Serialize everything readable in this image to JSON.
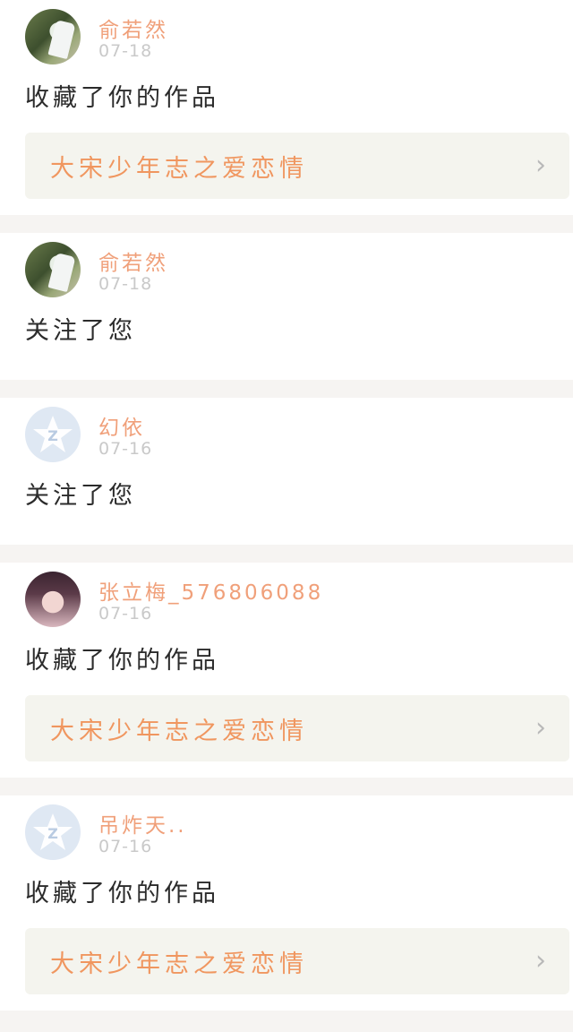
{
  "feed": {
    "items": [
      {
        "user": "俞若然",
        "time": "07-18",
        "action": "收藏了你的作品",
        "work_title": "大宋少年志之爱恋情",
        "avatar": "photo-outdoor"
      },
      {
        "user": "俞若然",
        "time": "07-18",
        "action": "关注了您",
        "avatar": "photo-outdoor"
      },
      {
        "user": "幻依",
        "time": "07-16",
        "action": "关注了您",
        "avatar": "default-qq-icon"
      },
      {
        "user": "张立梅_576806088",
        "time": "07-16",
        "action": "收藏了你的作品",
        "work_title": "大宋少年志之爱恋情",
        "avatar": "photo-girl"
      },
      {
        "user": "吊炸天..",
        "time": "07-16",
        "action": "收藏了你的作品",
        "work_title": "大宋少年志之爱恋情",
        "avatar": "default-qq-icon"
      }
    ]
  },
  "icons": {
    "chevron": "chevron-right-icon",
    "chevron_glyph": "›"
  },
  "colors": {
    "username": "#f0a07a",
    "work_title": "#f0965f",
    "time": "#c9c9c9",
    "card_bg": "#f4f4ee"
  }
}
